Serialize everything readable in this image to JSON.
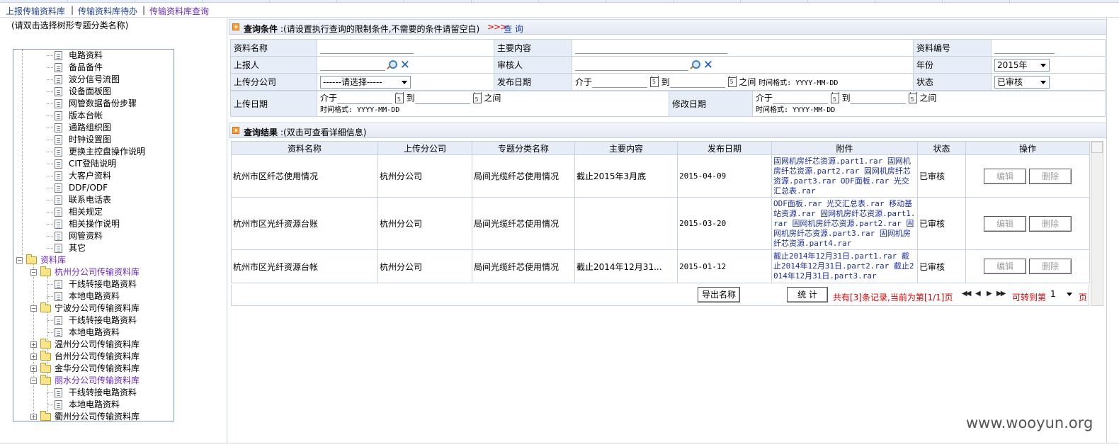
{
  "nav": {
    "items": [
      {
        "label": "上报传输资料库",
        "active": false
      },
      {
        "label": "传输资料库待办",
        "active": false
      },
      {
        "label": "传输资料库查询",
        "active": true
      }
    ],
    "separator": "|"
  },
  "tree": {
    "hint": "(请双击选择树形专题分类名称)",
    "nodes": [
      {
        "label": "电路资料",
        "type": "doc",
        "level": 2
      },
      {
        "label": "备品备件",
        "type": "doc",
        "level": 2
      },
      {
        "label": "波分信号流图",
        "type": "doc",
        "level": 2
      },
      {
        "label": "设备面板图",
        "type": "doc",
        "level": 2
      },
      {
        "label": "网管数据备份步骤",
        "type": "doc",
        "level": 2
      },
      {
        "label": "版本台帐",
        "type": "doc",
        "level": 2
      },
      {
        "label": "通路组织图",
        "type": "doc",
        "level": 2
      },
      {
        "label": "时钟设置图",
        "type": "doc",
        "level": 2
      },
      {
        "label": "更换主控盘操作说明",
        "type": "doc",
        "level": 2
      },
      {
        "label": "CIT登陆说明",
        "type": "doc",
        "level": 2
      },
      {
        "label": "大客户资料",
        "type": "doc",
        "level": 2
      },
      {
        "label": "DDF/ODF",
        "type": "doc",
        "level": 2
      },
      {
        "label": "联系电话表",
        "type": "doc",
        "level": 2
      },
      {
        "label": "相关规定",
        "type": "doc",
        "level": 2
      },
      {
        "label": "相关操作说明",
        "type": "doc",
        "level": 2
      },
      {
        "label": "网管资料",
        "type": "doc",
        "level": 2
      },
      {
        "label": "其它",
        "type": "doc",
        "level": 2
      },
      {
        "label": "资料库",
        "type": "folder",
        "level": 0,
        "toggle": "-",
        "purple": true
      },
      {
        "label": "杭州分公司传输资料库",
        "type": "folder",
        "level": 1,
        "toggle": "-",
        "purple": true
      },
      {
        "label": "干线转接电路资料",
        "type": "doc",
        "level": 2
      },
      {
        "label": "本地电路资料",
        "type": "doc",
        "level": 2
      },
      {
        "label": "宁波分公司传输资料库",
        "type": "folder",
        "level": 1,
        "toggle": "-",
        "purple": false
      },
      {
        "label": "干线转接电路资料",
        "type": "doc",
        "level": 2
      },
      {
        "label": "本地电路资料",
        "type": "doc",
        "level": 2
      },
      {
        "label": "温州分公司传输资料库",
        "type": "folder",
        "level": 1,
        "toggle": "+",
        "purple": false
      },
      {
        "label": "台州分公司传输资料库",
        "type": "folder",
        "level": 1,
        "toggle": "+",
        "purple": false
      },
      {
        "label": "金华分公司传输资料库",
        "type": "folder",
        "level": 1,
        "toggle": "+",
        "purple": false
      },
      {
        "label": "丽水分公司传输资料库",
        "type": "folder",
        "level": 1,
        "toggle": "-",
        "purple": true
      },
      {
        "label": "干线转接电路资料",
        "type": "doc",
        "level": 2
      },
      {
        "label": "本地电路资料",
        "type": "doc",
        "level": 2
      },
      {
        "label": "衢州分公司传输资料库",
        "type": "folder",
        "level": 1,
        "toggle": "+",
        "purple": false
      }
    ]
  },
  "query_section": {
    "title": "查询条件",
    "note": ":(请设置执行查询的限制条件,不需要的条件请留空白)",
    "chevrons": ">>>",
    "query_link": "查 询"
  },
  "form": {
    "labels": {
      "name": "资料名称",
      "content": "主要内容",
      "code": "资料编号",
      "reporter": "上报人",
      "auditor": "审核人",
      "year": "年份",
      "branch": "上传分公司",
      "publish_date": "发布日期",
      "status": "状态",
      "upload_date": "上传日期",
      "modify_date": "修改日期"
    },
    "branch_select": "------请选择-----",
    "year_select": "2015年",
    "status_select": "已审核",
    "between": "介于",
    "to": "到",
    "among": "之间",
    "format_inline": "时间格式: YYYY-MM-DD",
    "format_hint": "时间格式: YYYY-MM-DD"
  },
  "result_section": {
    "title": "查询结果",
    "note": ":(双击可查看详细信息)"
  },
  "grid": {
    "headers": [
      "资料名称",
      "上传分公司",
      "专题分类名称",
      "主要内容",
      "发布日期",
      "附件",
      "状态",
      "操作"
    ],
    "rows": [
      {
        "name": "杭州市区纤芯使用情况",
        "branch": "杭州分公司",
        "category": "局间光缆纤芯使用情况",
        "content": "截止2015年3月底",
        "date": "2015-04-09",
        "attachments": "固网机房纤芯资源.part1.rar 固网机房纤芯资源.part2.rar 固网机房纤芯资源.part3.rar ODF面板.rar 光交汇总表.rar",
        "status": "已审核"
      },
      {
        "name": "杭州市区光纤资源台账",
        "branch": "杭州分公司",
        "category": "局间光缆纤芯使用情况",
        "content": "",
        "date": "2015-03-20",
        "attachments": "ODF面板.rar 光交汇总表.rar 移动基站资源.rar 固网机房纤芯资源.part1.rar 固网机房纤芯资源.part2.rar 固网机房纤芯资源.part3.rar 固网机房纤芯资源.part4.rar",
        "status": "已审核"
      },
      {
        "name": "杭州市区光纤资源台帐",
        "branch": "杭州分公司",
        "category": "局间光缆纤芯使用情况",
        "content": "截止2014年12月31...",
        "date": "2015-01-12",
        "attachments": "截止2014年12月31日.part1.rar 截止2014年12月31日.part2.rar 截止2014年12月31日.part3.rar",
        "status": "已审核"
      }
    ],
    "edit_label": "编辑",
    "delete_label": "删除"
  },
  "pager": {
    "export_label": "导出名称",
    "stats_label": "统 计",
    "summary": "共有[3]条记录,当前为第[1/1]页",
    "goto_label": "可转到第",
    "page_select": "1",
    "page_suffix": "页"
  },
  "watermark": "www.wooyun.org",
  "colors": {
    "link_blue": "#1f3f9f",
    "link_purple": "#6a2bbf",
    "label_bg": "#e7edf6",
    "border": "#c7d2e2",
    "alert_red": "#dd0000"
  }
}
